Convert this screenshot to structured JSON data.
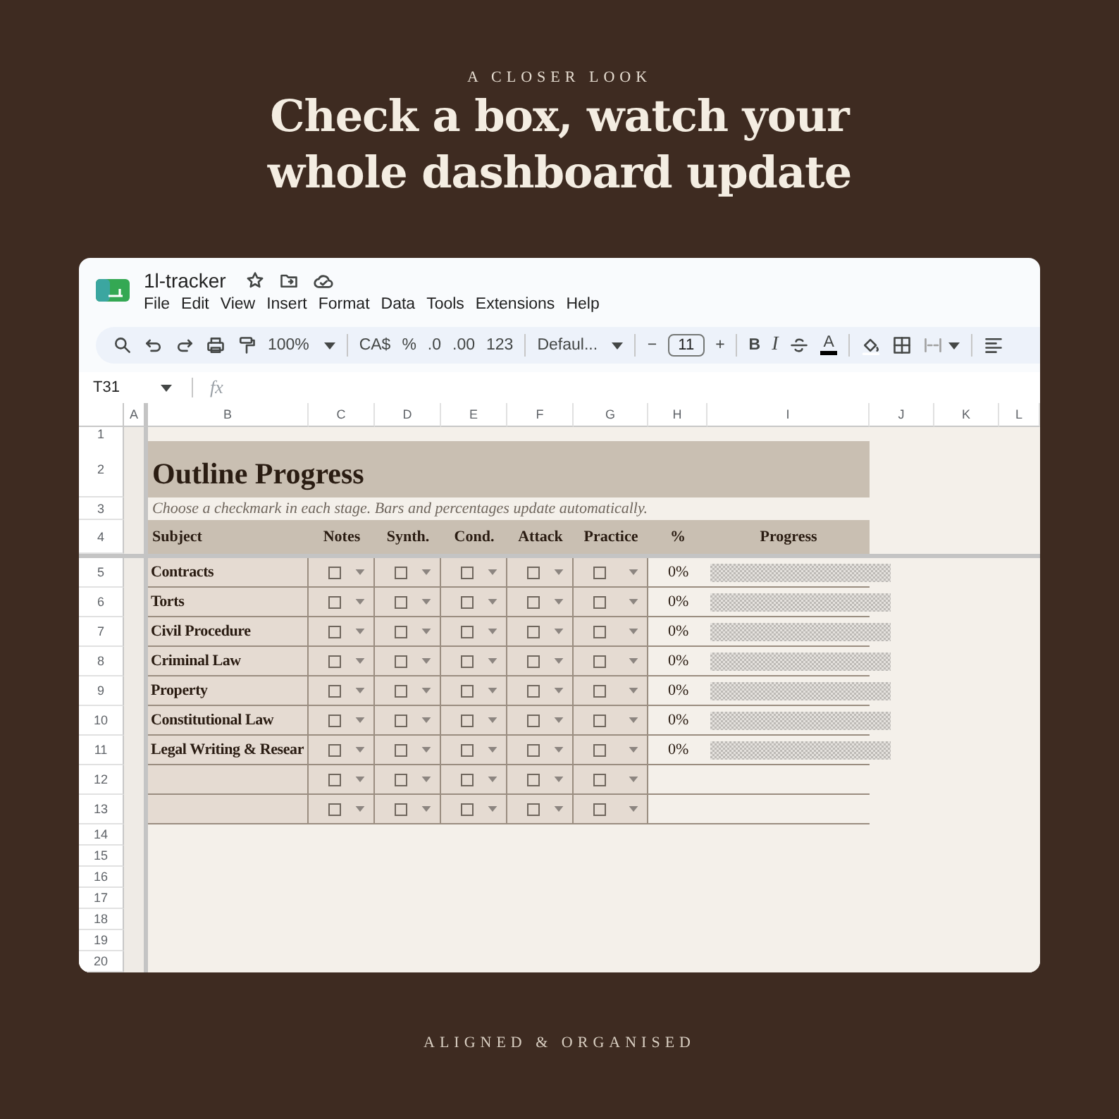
{
  "header": {
    "eyebrow": "A CLOSER LOOK",
    "title_lines": [
      "Check a box, watch your",
      "whole dashboard update"
    ]
  },
  "window": {
    "title": "1l-tracker",
    "menu": [
      "File",
      "Edit",
      "View",
      "Insert",
      "Format",
      "Data",
      "Tools",
      "Extensions",
      "Help"
    ]
  },
  "toolbar": {
    "zoom": "100%",
    "currency": "CA$",
    "percent": "%",
    "decrease_decimals": ".0",
    "increase_decimals": ".00",
    "number_format": "123",
    "font": "Defaul...",
    "decrease_size": "−",
    "font_size": "11",
    "increase_size": "+",
    "bold": "B",
    "italic": "I",
    "text_color": "A"
  },
  "formula_bar": {
    "cell_ref": "T31",
    "fx": "fx"
  },
  "sheet": {
    "columns": [
      "A",
      "B",
      "C",
      "D",
      "E",
      "F",
      "G",
      "H",
      "I",
      "J",
      "K",
      "L"
    ],
    "row_numbers": [
      "1",
      "2",
      "3",
      "4",
      "5",
      "6",
      "7",
      "8",
      "9",
      "10",
      "11",
      "12",
      "13",
      "14",
      "15",
      "16",
      "17",
      "18",
      "19",
      "20"
    ],
    "title": "Outline Progress",
    "note": "Choose a checkmark in each stage. Bars and percentages update automatically.",
    "headers": [
      "Subject",
      "Notes",
      "Synth.",
      "Cond.",
      "Attack",
      "Practice",
      "%",
      "Progress"
    ],
    "rows": [
      {
        "subject": "Contracts",
        "stages": [
          {
            "checked": false
          },
          {
            "checked": false
          },
          {
            "checked": false
          },
          {
            "checked": false
          },
          {
            "checked": false
          }
        ],
        "percent": "0%",
        "level": 0
      },
      {
        "subject": "Torts",
        "stages": [
          {
            "checked": false
          },
          {
            "checked": false
          },
          {
            "checked": false
          },
          {
            "checked": false
          },
          {
            "checked": false
          }
        ],
        "percent": "0%",
        "level": 0
      },
      {
        "subject": "Civil Procedure",
        "stages": [
          {
            "checked": false
          },
          {
            "checked": false
          },
          {
            "checked": false
          },
          {
            "checked": false
          },
          {
            "checked": false
          }
        ],
        "percent": "0%",
        "level": 0
      },
      {
        "subject": "Criminal Law",
        "stages": [
          {
            "checked": false
          },
          {
            "checked": false
          },
          {
            "checked": false
          },
          {
            "checked": false
          },
          {
            "checked": false
          }
        ],
        "percent": "0%",
        "level": 0
      },
      {
        "subject": "Property",
        "stages": [
          {
            "checked": false
          },
          {
            "checked": false
          },
          {
            "checked": false
          },
          {
            "checked": false
          },
          {
            "checked": false
          }
        ],
        "percent": "0%",
        "level": 0
      },
      {
        "subject": "Constitutional Law",
        "stages": [
          {
            "checked": false
          },
          {
            "checked": false
          },
          {
            "checked": false
          },
          {
            "checked": false
          },
          {
            "checked": false
          }
        ],
        "percent": "0%",
        "level": 0
      },
      {
        "subject": "Legal Writing & Resear",
        "stages": [
          {
            "checked": false
          },
          {
            "checked": false
          },
          {
            "checked": false
          },
          {
            "checked": false
          },
          {
            "checked": false
          }
        ],
        "percent": "0%",
        "level": 0
      },
      {
        "stages": [
          {
            "checked": false
          },
          {
            "checked": false
          },
          {
            "checked": false
          },
          {
            "checked": false
          },
          {
            "checked": false
          }
        ]
      },
      {
        "stages": [
          {
            "checked": false
          },
          {
            "checked": false
          },
          {
            "checked": false
          },
          {
            "checked": false
          },
          {
            "checked": false
          }
        ]
      }
    ]
  },
  "footer": "ALIGNED & ORGANISED"
}
